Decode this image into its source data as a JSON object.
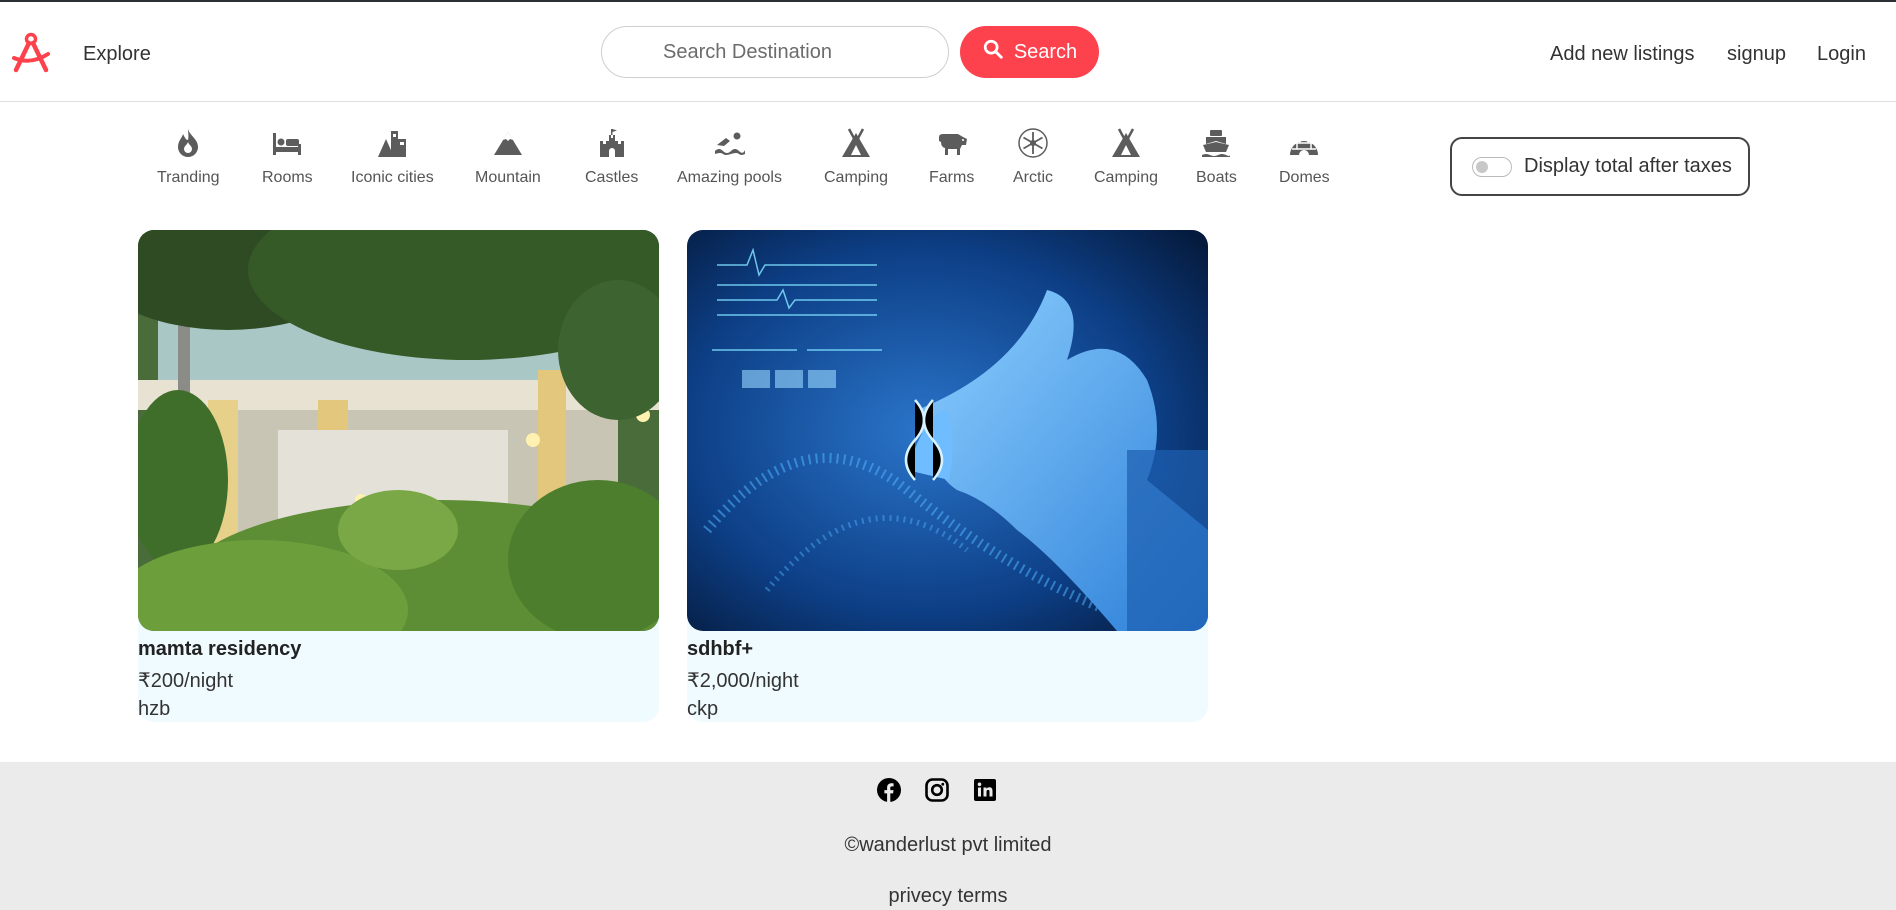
{
  "colors": {
    "brand": "#fe424d",
    "card_bg": "#f0fbff",
    "footer_bg": "#ebebeb"
  },
  "navbar": {
    "logo_icon": "compass-icon",
    "explore": "Explore",
    "search_placeholder": "Search Destination",
    "search_button": "Search",
    "search_icon": "search-icon",
    "add_listing": "Add new listings",
    "signup": "signup",
    "login": "Login"
  },
  "filters": [
    {
      "label": "Tranding",
      "icon": "fire-icon"
    },
    {
      "label": "Rooms",
      "icon": "bed-icon"
    },
    {
      "label": "Iconic cities",
      "icon": "city-icon"
    },
    {
      "label": "Mountain",
      "icon": "mountain-icon"
    },
    {
      "label": "Castles",
      "icon": "castle-icon"
    },
    {
      "label": "Amazing pools",
      "icon": "swimmer-icon"
    },
    {
      "label": "Camping",
      "icon": "tent-icon"
    },
    {
      "label": "Farms",
      "icon": "cow-icon"
    },
    {
      "label": "Arctic",
      "icon": "snowflake-icon"
    },
    {
      "label": "Camping",
      "icon": "tent-icon"
    },
    {
      "label": "Boats",
      "icon": "ship-icon"
    },
    {
      "label": "Domes",
      "icon": "igloo-icon"
    }
  ],
  "tax_toggle": {
    "label": "Display total after taxes",
    "checked": false
  },
  "listings": [
    {
      "title": "mamta residency",
      "price": "₹200/night",
      "location": "hzb"
    },
    {
      "title": "sdhbf+",
      "price": "₹2,000/night",
      "location": "ckp"
    }
  ],
  "footer": {
    "socials": [
      "facebook-icon",
      "instagram-icon",
      "linkedin-icon"
    ],
    "copyright": "©wanderlust pvt limited",
    "links": "privecy terms"
  }
}
